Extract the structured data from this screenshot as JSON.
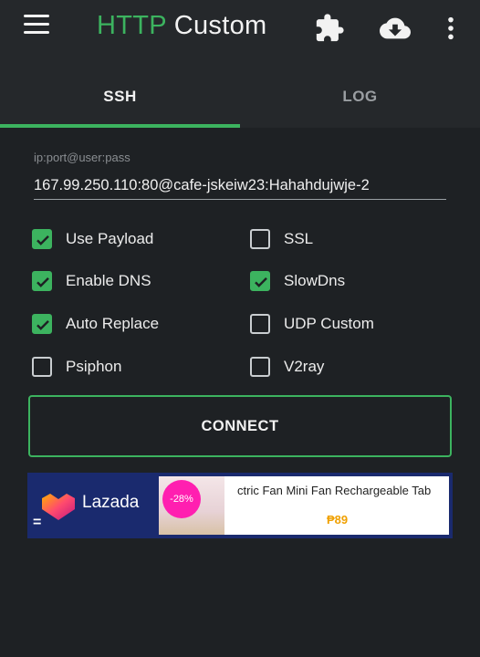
{
  "header": {
    "title_part1": "HTTP",
    "title_part2": "Custom",
    "icons": [
      "menu-icon",
      "puzzle-icon",
      "cloud-download-icon",
      "more-vert-icon"
    ]
  },
  "tabs": [
    {
      "label": "SSH",
      "active": true
    },
    {
      "label": "LOG",
      "active": false
    }
  ],
  "ssh": {
    "field_label": "ip:port@user:pass",
    "field_value": "167.99.250.110:80@cafe-jskeiw23:Hahahdujwje-2"
  },
  "options": [
    {
      "label": "Use Payload",
      "checked": true
    },
    {
      "label": "SSL",
      "checked": false
    },
    {
      "label": "Enable DNS",
      "checked": true
    },
    {
      "label": "SlowDns",
      "checked": true
    },
    {
      "label": "Auto Replace",
      "checked": true
    },
    {
      "label": "UDP Custom",
      "checked": false
    },
    {
      "label": "Psiphon",
      "checked": false
    },
    {
      "label": "V2ray",
      "checked": false
    }
  ],
  "connect_label": "CONNECT",
  "ad": {
    "brand": "Lazada",
    "menu_glyph": "=",
    "discount": "-28%",
    "product_text": "ctric Fan Mini Fan Rechargeable Tab",
    "price": "₱89"
  },
  "colors": {
    "accent": "#3cb35f",
    "background": "#1e2124",
    "appbar": "#25282b"
  }
}
